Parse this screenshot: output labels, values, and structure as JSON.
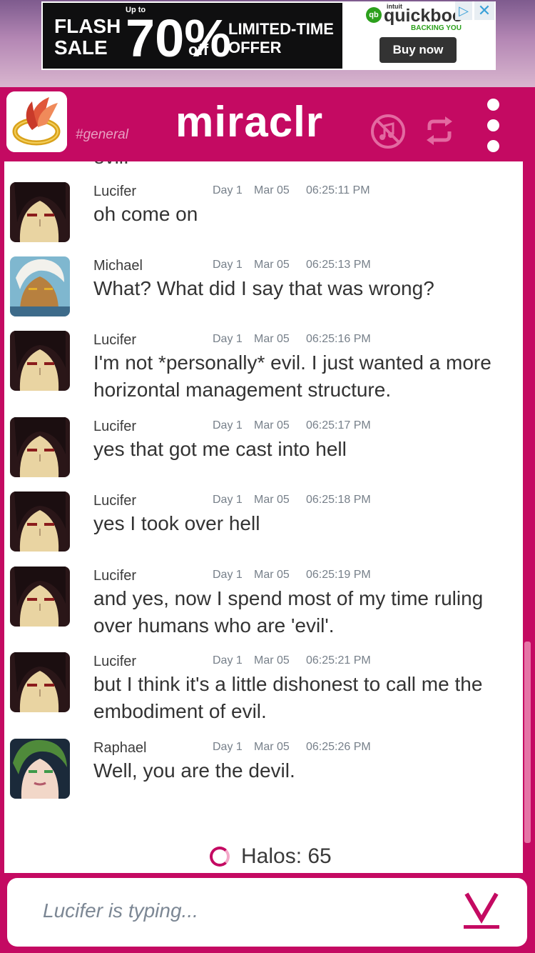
{
  "ad": {
    "flash_sale": "FLASH SALE",
    "up_to": "Up to",
    "percent": "70%",
    "off": "off",
    "limited": "LIMITED-TIME OFFER",
    "brand_small": "intuit",
    "brand": "quickboo",
    "tagline": "BACKING YOU",
    "buy_now": "Buy now",
    "qb_logo": "qb",
    "adchoices_icon": "▷",
    "close_icon": "✕"
  },
  "header": {
    "channel": "#general",
    "app_name": "miraclr",
    "icons": [
      "no-music-icon",
      "sync-icon",
      "menu-dots-icon"
    ],
    "accent_color": "#c40a62"
  },
  "chat": {
    "cut_off_text": "evil.",
    "messages": [
      {
        "user": "Lucifer",
        "day": "Day 1",
        "date": "Mar 05",
        "time": "06:25:11 PM",
        "text": "oh come on",
        "avatar": "lucifer"
      },
      {
        "user": "Michael",
        "day": "Day 1",
        "date": "Mar 05",
        "time": "06:25:13 PM",
        "text": "What? What did I say that was wrong?",
        "avatar": "michael"
      },
      {
        "user": "Lucifer",
        "day": "Day 1",
        "date": "Mar 05",
        "time": "06:25:16 PM",
        "text": "I'm not *personally* evil. I just wanted a more horizontal management structure.",
        "avatar": "lucifer"
      },
      {
        "user": "Lucifer",
        "day": "Day 1",
        "date": "Mar 05",
        "time": "06:25:17 PM",
        "text": "yes that got me cast into hell",
        "avatar": "lucifer"
      },
      {
        "user": "Lucifer",
        "day": "Day 1",
        "date": "Mar 05",
        "time": "06:25:18 PM",
        "text": "yes I took over hell",
        "avatar": "lucifer"
      },
      {
        "user": "Lucifer",
        "day": "Day 1",
        "date": "Mar 05",
        "time": "06:25:19 PM",
        "text": "and yes, now I spend most of my time ruling over humans who are 'evil'.",
        "avatar": "lucifer"
      },
      {
        "user": "Lucifer",
        "day": "Day 1",
        "date": "Mar 05",
        "time": "06:25:21 PM",
        "text": "but I think it's a little dishonest to call me the embodiment of evil.",
        "avatar": "lucifer"
      },
      {
        "user": "Raphael",
        "day": "Day 1",
        "date": "Mar 05",
        "time": "06:25:26 PM",
        "text": "Well, you are the devil.",
        "avatar": "raphael"
      }
    ],
    "halos": "Halos: 65"
  },
  "input": {
    "typing_status": "Lucifer is typing..."
  }
}
